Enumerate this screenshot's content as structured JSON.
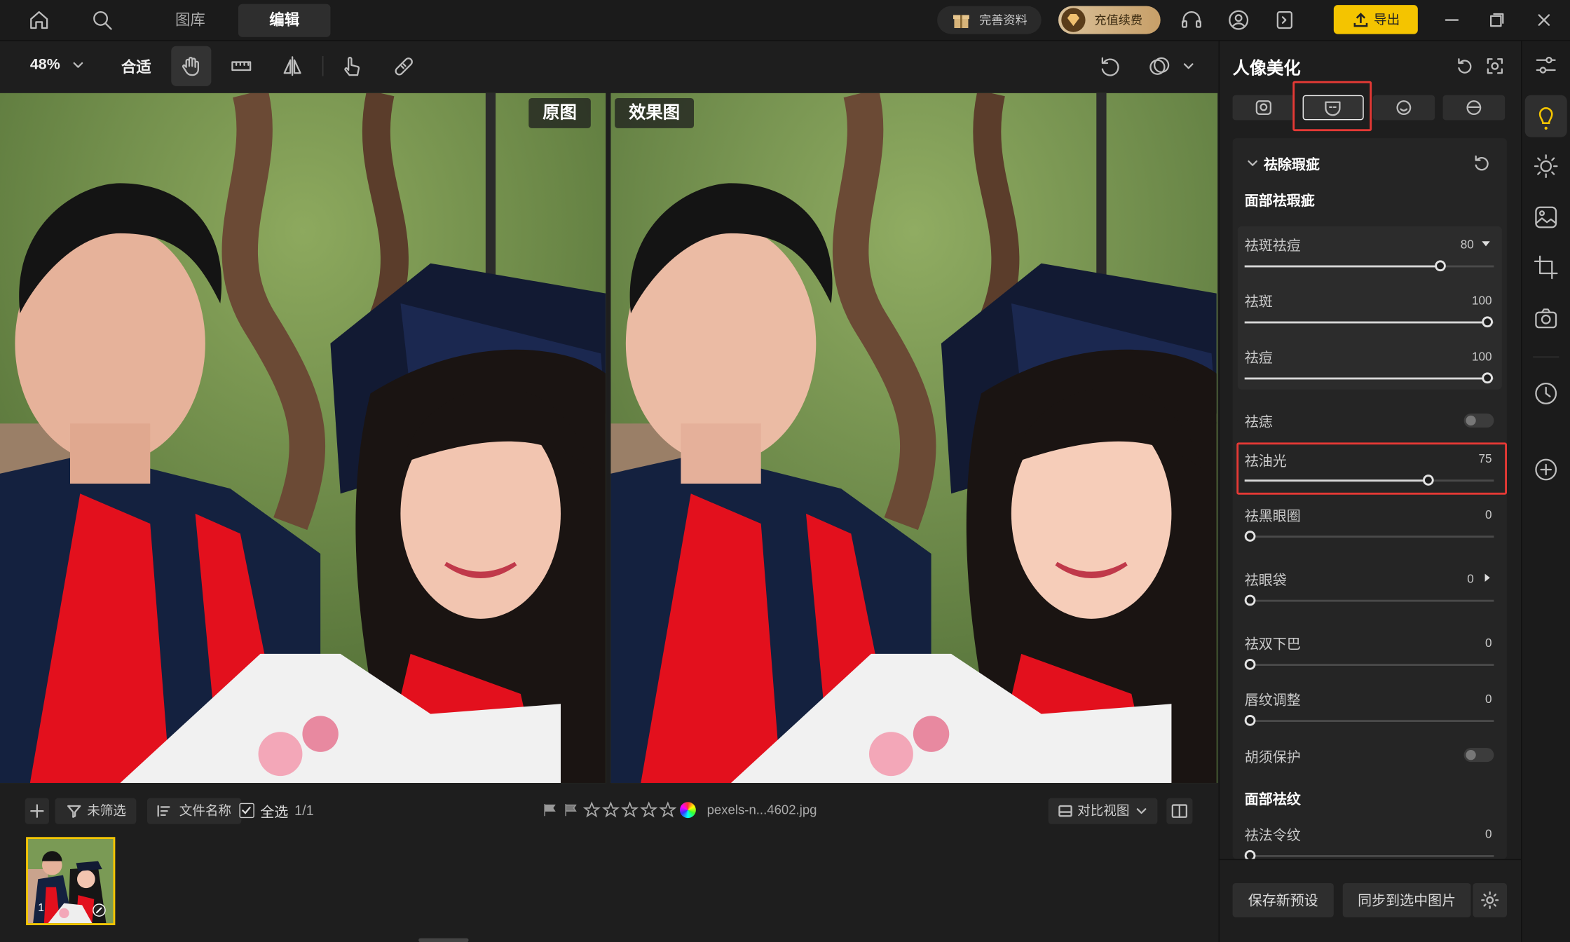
{
  "topbar": {
    "tab_library": "图库",
    "tab_edit": "编辑",
    "complete_profile": "完善资料",
    "vip_recharge": "充值续费",
    "export_label": "导出"
  },
  "toolbar": {
    "zoom": "48%",
    "fit": "合适"
  },
  "canvas": {
    "original_label": "原图",
    "result_label": "效果图"
  },
  "bottombar": {
    "filter_label": "未筛选",
    "sort_label": "文件名称",
    "select_all_label": "全选",
    "selection_count": "1/1",
    "file_name": "pexels-n...4602.jpg",
    "compare_view_label": "对比视图",
    "thumbnail_index": "1"
  },
  "panel": {
    "title": "人像美化",
    "section_title": "祛除瑕疵",
    "group_face_blemish": "面部祛瑕疵",
    "sliders": [
      {
        "label": "祛斑祛痘",
        "value": "80"
      },
      {
        "label": "祛斑",
        "value": "100"
      },
      {
        "label": "祛痘",
        "value": "100"
      },
      {
        "label": "祛油光",
        "value": "75"
      },
      {
        "label": "祛黑眼圈",
        "value": "0"
      },
      {
        "label": "祛眼袋",
        "value": "0"
      },
      {
        "label": "祛双下巴",
        "value": "0"
      },
      {
        "label": "唇纹调整",
        "value": "0"
      },
      {
        "label": "祛法令纹",
        "value": "0"
      }
    ],
    "toggle_mole": "祛痣",
    "toggle_beard": "胡须保护",
    "group_face_wrinkle": "面部祛纹",
    "save_preset": "保存新预设",
    "sync_selected": "同步到选中图片"
  },
  "colors": {
    "accent": "#f4c400",
    "highlight_border": "#e53935"
  }
}
